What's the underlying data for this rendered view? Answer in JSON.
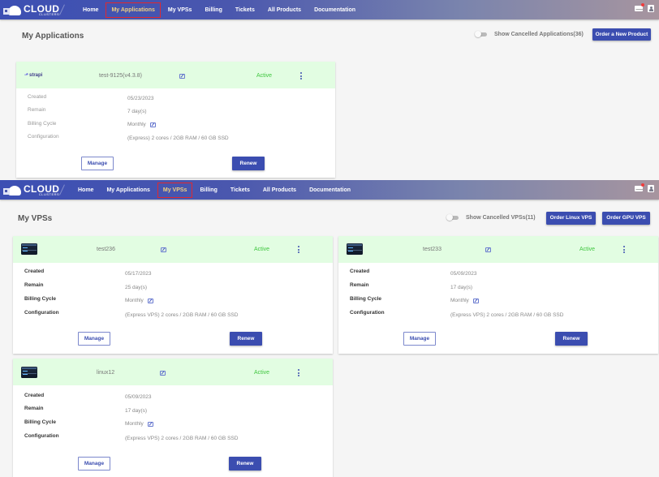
{
  "brand": {
    "line1": "CLOUD",
    "line2": "CLUSTERS"
  },
  "nav": {
    "items": [
      {
        "label": "Home"
      },
      {
        "label": "My Applications"
      },
      {
        "label": "My VPSs"
      },
      {
        "label": "Billing"
      },
      {
        "label": "Tickets"
      },
      {
        "label": "All Products"
      },
      {
        "label": "Documentation"
      }
    ]
  },
  "top_icons": {
    "mail": "mail-icon",
    "mail_badge": "unread-dot",
    "user": "user-icon"
  },
  "colors": {
    "accent": "#3b4db0",
    "active_status": "#3fc63f",
    "card_header": "#e2fde2",
    "nav_highlight_border": "#e0292f",
    "notification_dot": "#f03c3c"
  },
  "applications_page": {
    "active_nav": "My Applications",
    "title": "My Applications",
    "toggle_label": "Show Cancelled Applications(36)",
    "toggle_on": false,
    "order_button": "Order a New Product",
    "cards": [
      {
        "logo": "strapi",
        "logo_mark": "⬏",
        "name": "test-9125(v4.3.8)",
        "status": "Active",
        "rows": [
          {
            "label": "Created",
            "value": "05/23/2023"
          },
          {
            "label": "Remain",
            "value": "7 day(s)"
          },
          {
            "label": "Billing Cycle",
            "value": "Monthly",
            "editable": true
          },
          {
            "label": "Configuration",
            "value": "(Express) 2 cores / 2GB RAM / 60 GB SSD"
          }
        ],
        "manage_label": "Manage",
        "renew_label": "Renew"
      }
    ]
  },
  "vps_page": {
    "active_nav": "My VPSs",
    "title": "My VPSs",
    "toggle_label": "Show Cancelled VPSs(11)",
    "toggle_on": false,
    "order_linux_button": "Order Linux VPS",
    "order_gpu_button": "Order GPU VPS",
    "cards": [
      {
        "name": "test236",
        "status": "Active",
        "rows": [
          {
            "label": "Created",
            "value": "05/17/2023"
          },
          {
            "label": "Remain",
            "value": "25 day(s)"
          },
          {
            "label": "Billing Cycle",
            "value": "Monthly",
            "editable": true
          },
          {
            "label": "Configuration",
            "value": "(Express VPS) 2 cores / 2GB RAM / 60 GB SSD"
          }
        ],
        "manage_label": "Manage",
        "renew_label": "Renew"
      },
      {
        "name": "test233",
        "status": "Active",
        "rows": [
          {
            "label": "Created",
            "value": "05/09/2023"
          },
          {
            "label": "Remain",
            "value": "17 day(s)"
          },
          {
            "label": "Billing Cycle",
            "value": "Monthly",
            "editable": true
          },
          {
            "label": "Configuration",
            "value": "(Express VPS) 2 cores / 2GB RAM / 60 GB SSD"
          }
        ],
        "manage_label": "Manage",
        "renew_label": "Renew"
      },
      {
        "name": "linux12",
        "status": "Active",
        "rows": [
          {
            "label": "Created",
            "value": "05/09/2023"
          },
          {
            "label": "Remain",
            "value": "17 day(s)"
          },
          {
            "label": "Billing Cycle",
            "value": "Monthly",
            "editable": true
          },
          {
            "label": "Configuration",
            "value": "(Express VPS) 2 cores / 2GB RAM / 60 GB SSD"
          }
        ],
        "manage_label": "Manage",
        "renew_label": "Renew"
      }
    ]
  }
}
